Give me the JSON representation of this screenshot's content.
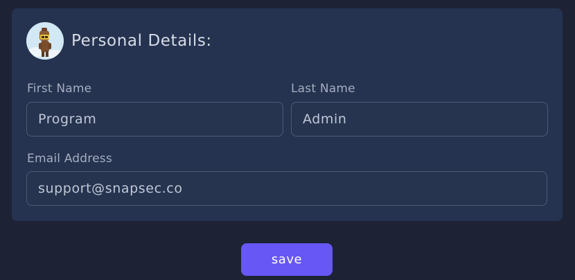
{
  "section": {
    "title": "Personal Details:"
  },
  "form": {
    "first_name_label": "First Name",
    "first_name_value": "Program",
    "last_name_label": "Last Name",
    "last_name_value": "Admin",
    "email_label": "Email Address",
    "email_value": "support@snapsec.co"
  },
  "actions": {
    "save_label": "save"
  },
  "colors": {
    "page_background": "#1d2335",
    "card_background": "#253350",
    "accent": "#6757f4"
  }
}
